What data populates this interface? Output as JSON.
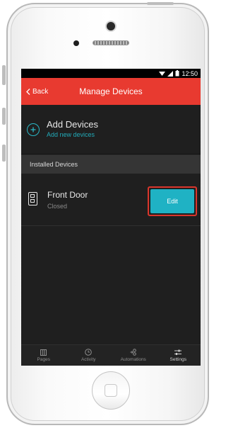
{
  "status_bar": {
    "time": "12:50"
  },
  "header": {
    "back_label": "Back",
    "title": "Manage Devices"
  },
  "add_devices": {
    "title": "Add Devices",
    "subtitle": "Add new devices"
  },
  "installed": {
    "section_label": "Installed Devices",
    "devices": [
      {
        "name": "Front Door",
        "status": "Closed",
        "action_label": "Edit"
      }
    ]
  },
  "tabs": [
    {
      "label": "Pages",
      "icon": "pages-icon"
    },
    {
      "label": "Activity",
      "icon": "clock-icon"
    },
    {
      "label": "Automations",
      "icon": "automations-icon"
    },
    {
      "label": "Settings",
      "icon": "sliders-icon",
      "active": true
    }
  ],
  "colors": {
    "accent_red": "#e83a30",
    "accent_teal": "#1fb2c4",
    "highlight_outline": "#d9362c"
  }
}
